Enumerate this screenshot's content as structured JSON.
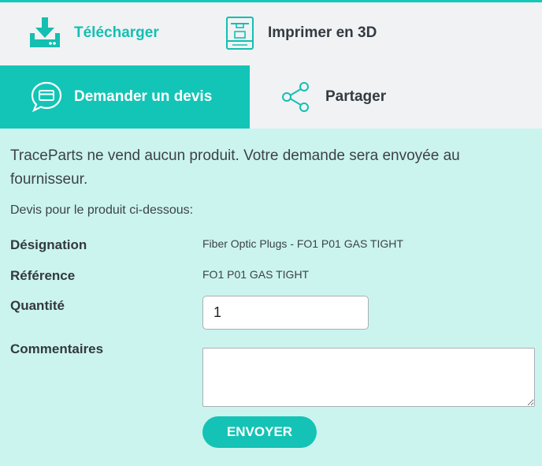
{
  "tabs": {
    "download_label": "Télécharger",
    "print_label": "Imprimer en 3D",
    "quote_label": "Demander un devis",
    "share_label": "Partager"
  },
  "form": {
    "notice": "TraceParts ne vend aucun produit. Votre demande sera envoyée au fournisseur.",
    "subtitle": "Devis pour le produit ci-dessous:",
    "designation_label": "Désignation",
    "designation_value": "Fiber Optic Plugs - FO1 P01 GAS TIGHT",
    "reference_label": "Référence",
    "reference_value": "FO1 P01 GAS TIGHT",
    "quantity_label": "Quantité",
    "quantity_value": "1",
    "comments_label": "Commentaires",
    "comments_value": "",
    "send_label": "ENVOYER"
  },
  "colors": {
    "accent": "#14c3b5",
    "panel_bg": "#cbf4ef",
    "tab_bg": "#f0f2f4",
    "text": "#333a40"
  },
  "icons": {
    "download": "download-icon",
    "print": "3d-printer-icon",
    "quote": "quote-chat-icon",
    "share": "share-icon"
  }
}
